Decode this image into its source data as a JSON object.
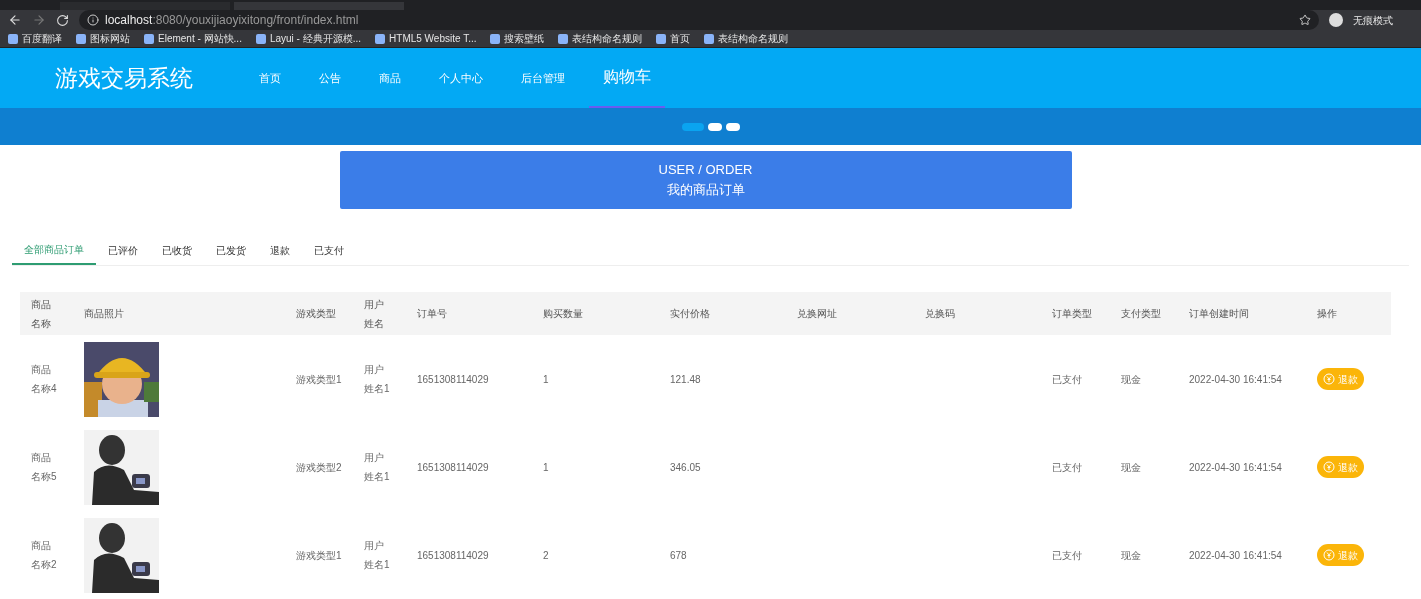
{
  "browser": {
    "address": {
      "host": "localhost",
      "path": ":8080/youxijiaoyixitong/front/index.html"
    },
    "incognito_label": "无痕模式",
    "bookmarks": [
      {
        "label": "百度翻译"
      },
      {
        "label": "图标网站"
      },
      {
        "label": "Element - 网站快..."
      },
      {
        "label": "Layui - 经典开源模..."
      },
      {
        "label": "HTML5 Website T..."
      },
      {
        "label": "搜索壁纸"
      },
      {
        "label": "表结构命名规则"
      },
      {
        "label": "首页"
      },
      {
        "label": "表结构命名规则"
      }
    ]
  },
  "nav": {
    "brand": "游戏交易系统",
    "items": [
      {
        "label": "首页",
        "selected": false
      },
      {
        "label": "公告",
        "selected": false
      },
      {
        "label": "商品",
        "selected": false
      },
      {
        "label": "个人中心",
        "selected": false
      },
      {
        "label": "后台管理",
        "selected": false
      },
      {
        "label": "购物车",
        "selected": true
      }
    ]
  },
  "carousel": {
    "dots": [
      {
        "selected": true
      },
      {
        "selected": false
      },
      {
        "selected": false
      }
    ]
  },
  "header_card": {
    "subtitle": "USER / ORDER",
    "title": "我的商品订单"
  },
  "order_tabs": [
    {
      "label": "全部商品订单",
      "selected": true
    },
    {
      "label": "已评价",
      "selected": false
    },
    {
      "label": "已收货",
      "selected": false
    },
    {
      "label": "已发货",
      "selected": false
    },
    {
      "label": "退款",
      "selected": false
    },
    {
      "label": "已支付",
      "selected": false
    }
  ],
  "table": {
    "columns": [
      "商品名称",
      "商品照片",
      "游戏类型",
      "用户姓名",
      "订单号",
      "购买数量",
      "实付价格",
      "兑换网址",
      "兑换码",
      "订单类型",
      "支付类型",
      "订单创建时间",
      "操作"
    ],
    "rows": [
      {
        "name": "商品名称4",
        "game_type": "游戏类型1",
        "user_name": "用户姓名1",
        "order_no": "1651308114029",
        "quantity": "1",
        "price": "121.48",
        "order_type": "已支付",
        "pay_type": "现金",
        "created": "2022-04-30 16:41:54",
        "action": "退款"
      },
      {
        "name": "商品名称5",
        "game_type": "游戏类型2",
        "user_name": "用户姓名1",
        "order_no": "1651308114029",
        "quantity": "1",
        "price": "346.05",
        "order_type": "已支付",
        "pay_type": "现金",
        "created": "2022-04-30 16:41:54",
        "action": "退款"
      },
      {
        "name": "商品名称2",
        "game_type": "游戏类型1",
        "user_name": "用户姓名1",
        "order_no": "1651308114029",
        "quantity": "2",
        "price": "678",
        "order_type": "已支付",
        "pay_type": "现金",
        "created": "2022-04-30 16:41:54",
        "action": "退款"
      }
    ]
  }
}
